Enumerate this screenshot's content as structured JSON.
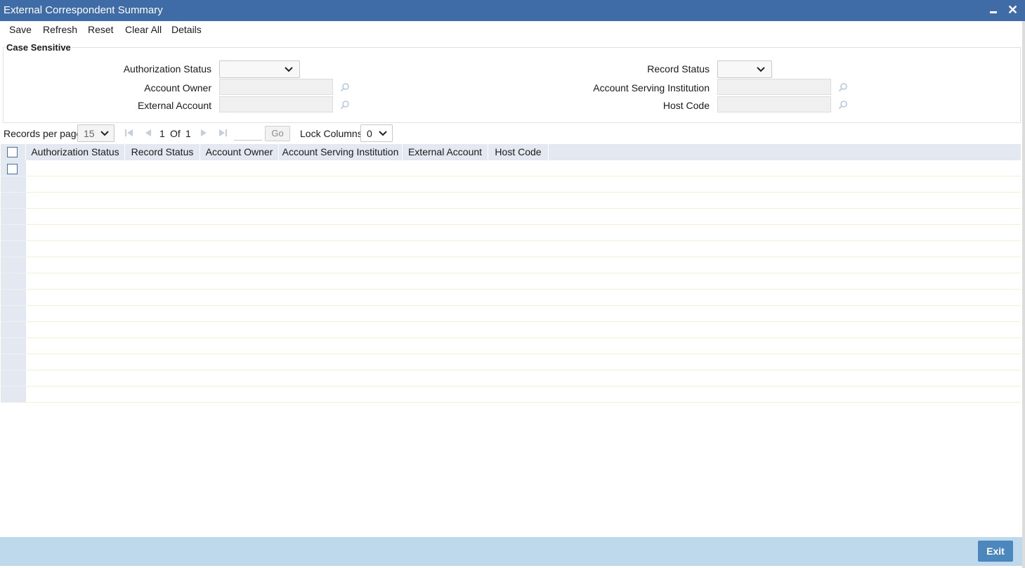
{
  "window": {
    "title": "External Correspondent Summary"
  },
  "toolbar": {
    "save": "Save",
    "refresh": "Refresh",
    "reset": "Reset",
    "clear_all": "Clear All",
    "details": "Details"
  },
  "search": {
    "legend": "Case Sensitive",
    "authorization_status_label": "Authorization Status",
    "authorization_status_value": "",
    "record_status_label": "Record Status",
    "record_status_value": "",
    "account_owner_label": "Account Owner",
    "account_owner_value": "",
    "account_serving_institution_label": "Account Serving Institution",
    "account_serving_institution_value": "",
    "external_account_label": "External Account",
    "external_account_value": "",
    "host_code_label": "Host Code",
    "host_code_value": ""
  },
  "pager": {
    "records_per_page_label": "Records per page",
    "records_per_page": "15",
    "current_page": "1",
    "of_label": "Of",
    "total_pages": "1",
    "go_label": "Go",
    "lock_columns_label": "Lock Columns",
    "lock_columns": "0"
  },
  "grid": {
    "columns": [
      "Authorization Status",
      "Record Status",
      "Account Owner",
      "Account Serving Institution",
      "External Account",
      "Host Code"
    ],
    "rows": []
  },
  "footer": {
    "exit": "Exit"
  },
  "colors": {
    "titlebar": "#3f6ca7",
    "header_bg": "#e3e8f1",
    "footer_bg": "#bed9ec",
    "exit_button": "#4b87bd"
  },
  "icons": [
    "minimize-icon",
    "close-icon",
    "chevron-down-icon",
    "search-lov-icon",
    "first-page-icon",
    "prev-page-icon",
    "next-page-icon",
    "last-page-icon"
  ]
}
